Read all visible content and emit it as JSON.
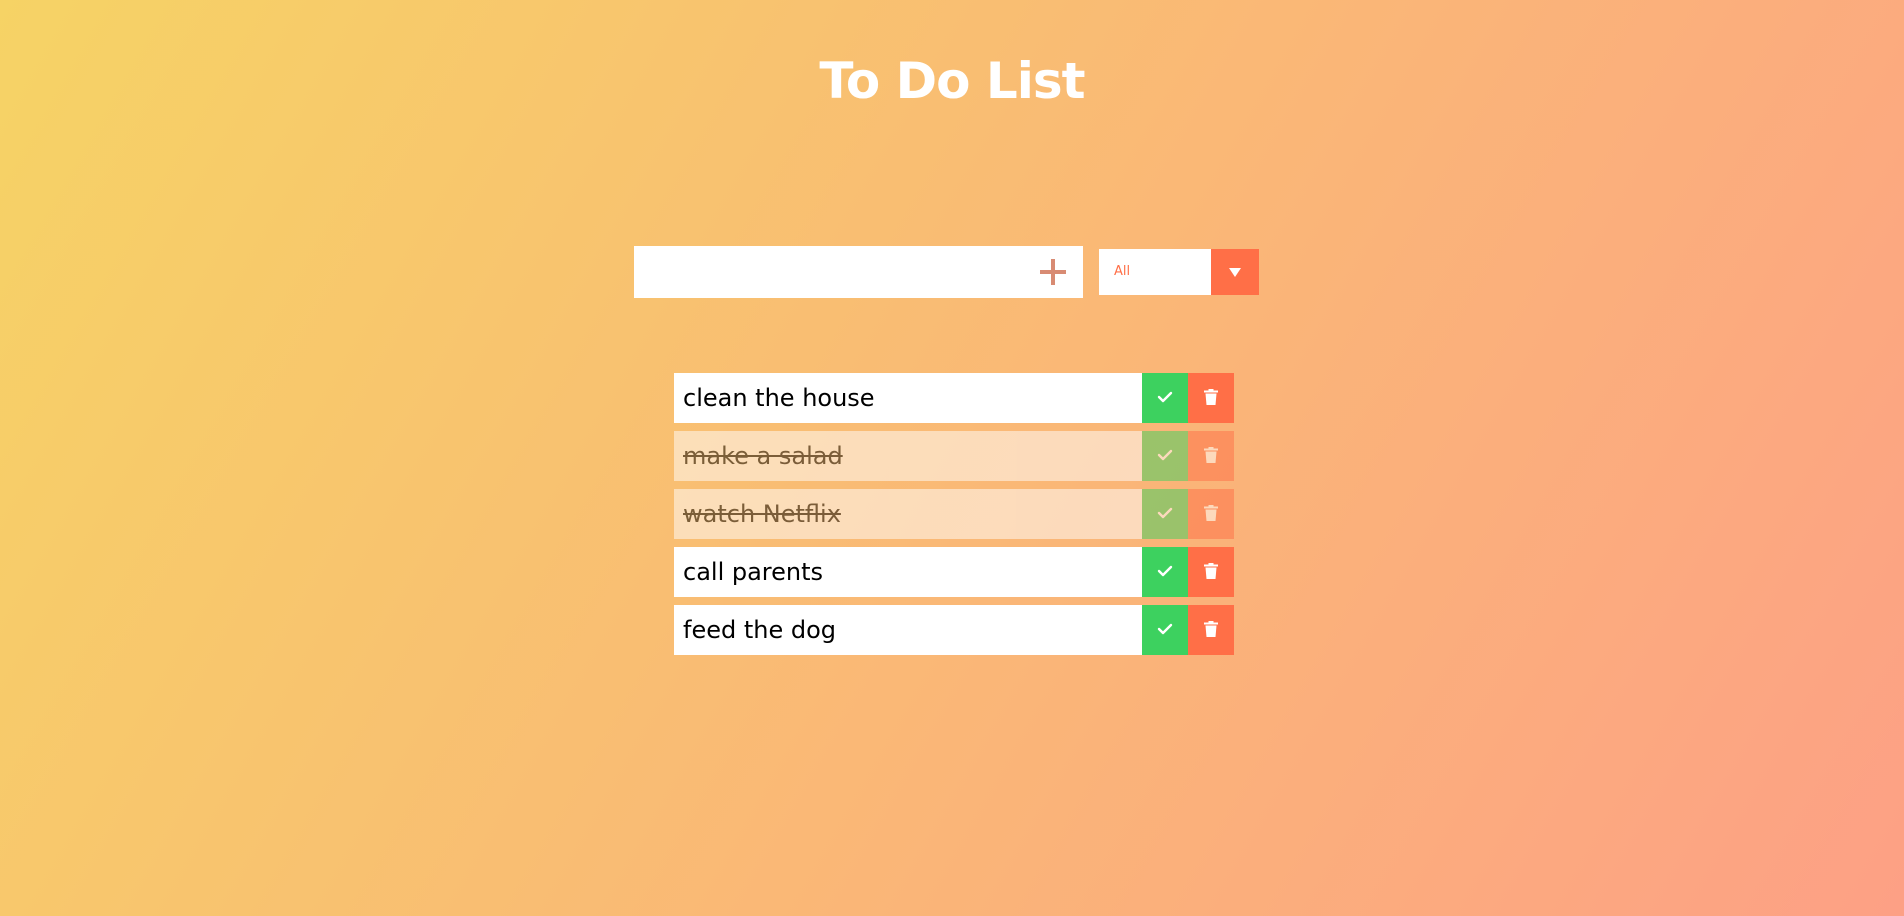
{
  "header": {
    "title": "To Do List"
  },
  "form": {
    "input_value": "",
    "add_icon": "plus-icon"
  },
  "filter": {
    "selected": "All",
    "arrow_icon": "caret-down-icon"
  },
  "todos": [
    {
      "text": "clean the house",
      "completed": false
    },
    {
      "text": "make a salad",
      "completed": true
    },
    {
      "text": "watch Netflix",
      "completed": true
    },
    {
      "text": "call parents",
      "completed": false
    },
    {
      "text": "feed the dog",
      "completed": false
    }
  ],
  "colors": {
    "gradient_start": "#f6d365",
    "gradient_end": "#fda085",
    "accent": "#ff6f47",
    "complete": "#3dd15f",
    "plus": "#d88b73"
  }
}
